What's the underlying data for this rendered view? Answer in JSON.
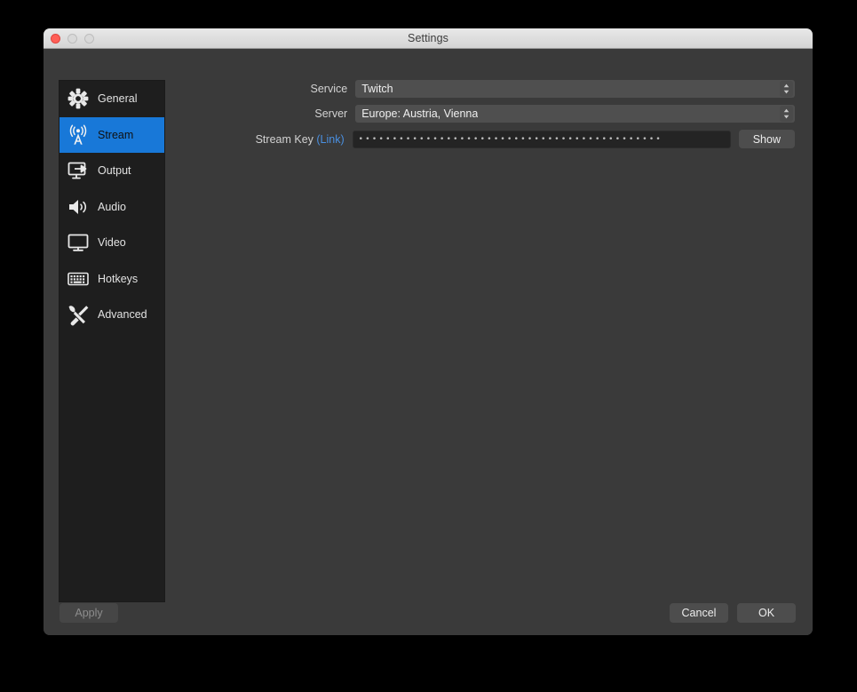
{
  "window": {
    "title": "Settings",
    "traffic_lights": [
      "close-button",
      "minimize-button",
      "zoom-button"
    ]
  },
  "sidebar": {
    "items": [
      {
        "label": "General",
        "icon": "gear-icon",
        "selected": false
      },
      {
        "label": "Stream",
        "icon": "broadcast-icon",
        "selected": true
      },
      {
        "label": "Output",
        "icon": "output-icon",
        "selected": false
      },
      {
        "label": "Audio",
        "icon": "speaker-icon",
        "selected": false
      },
      {
        "label": "Video",
        "icon": "monitor-icon",
        "selected": false
      },
      {
        "label": "Hotkeys",
        "icon": "keyboard-icon",
        "selected": false
      },
      {
        "label": "Advanced",
        "icon": "tools-icon",
        "selected": false
      }
    ]
  },
  "form": {
    "service": {
      "label": "Service",
      "value": "Twitch"
    },
    "server": {
      "label": "Server",
      "value": "Europe: Austria, Vienna"
    },
    "stream_key": {
      "label": "Stream Key",
      "link_label": "(Link)",
      "masked_value": "•••••••••••••••••••••••••••••••••••••••••••••",
      "show_button": "Show"
    }
  },
  "footer": {
    "apply": "Apply",
    "cancel": "Cancel",
    "ok": "OK"
  },
  "colors": {
    "accent_blue": "#1878d8",
    "link_blue": "#4a90e2",
    "window_bg": "#3a3a3a",
    "sidebar_bg": "#1e1e1e",
    "field_bg": "#4f4f4f",
    "close_red": "#ff5f57"
  }
}
